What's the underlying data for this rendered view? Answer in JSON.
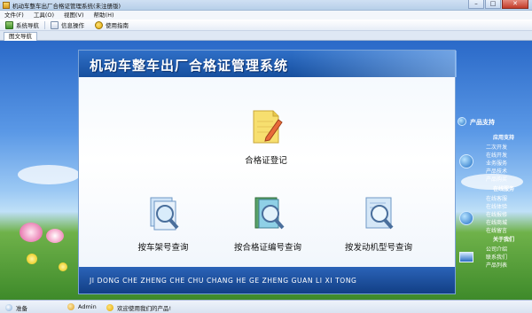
{
  "window": {
    "title": "机动车整车出厂合格证管理系统(未注册版)",
    "buttons": {
      "minimize": "–",
      "maximize": "□",
      "close": "✕"
    }
  },
  "menubar": {
    "items": [
      "文件(F)",
      "工具(O)",
      "视图(V)",
      "帮助(H)"
    ]
  },
  "toolbar": {
    "system_nav": "系统导航",
    "info_ops": "信息操作",
    "help_guide": "使用指南"
  },
  "tabs": [
    "图文导航"
  ],
  "panel": {
    "title": "机动车整车出厂合格证管理系统",
    "footer": "JI DONG CHE ZHENG CHE CHU CHANG HE GE ZHENG GUAN LI XI TONG",
    "actions": {
      "register": "合格证登记",
      "by_frame": "按车架号查询",
      "by_cert": "按合格证编号查询",
      "by_engine": "按发动机型号查询"
    }
  },
  "sidebar": {
    "product_support": "产品支持",
    "app_support": "应用支持",
    "app_items": [
      "二次开发",
      "在线开发",
      "业务服务",
      "产品技术",
      "产品购买"
    ],
    "online_service": "在线服务",
    "service_items": [
      "在线客服",
      "在线体验",
      "在线报修",
      "在线商城",
      "在线留言"
    ],
    "about_us": "关于我们",
    "about_items": [
      "公司介绍",
      "联系我们",
      "产品列表"
    ]
  },
  "statusbar": {
    "ready": "准备",
    "user": "Admin",
    "welcome": "欢迎使用我们的产品!"
  },
  "colors": {
    "header_blue": "#1d58ad",
    "footer_blue": "#174a96",
    "status_bg": "#dfe8f4"
  }
}
